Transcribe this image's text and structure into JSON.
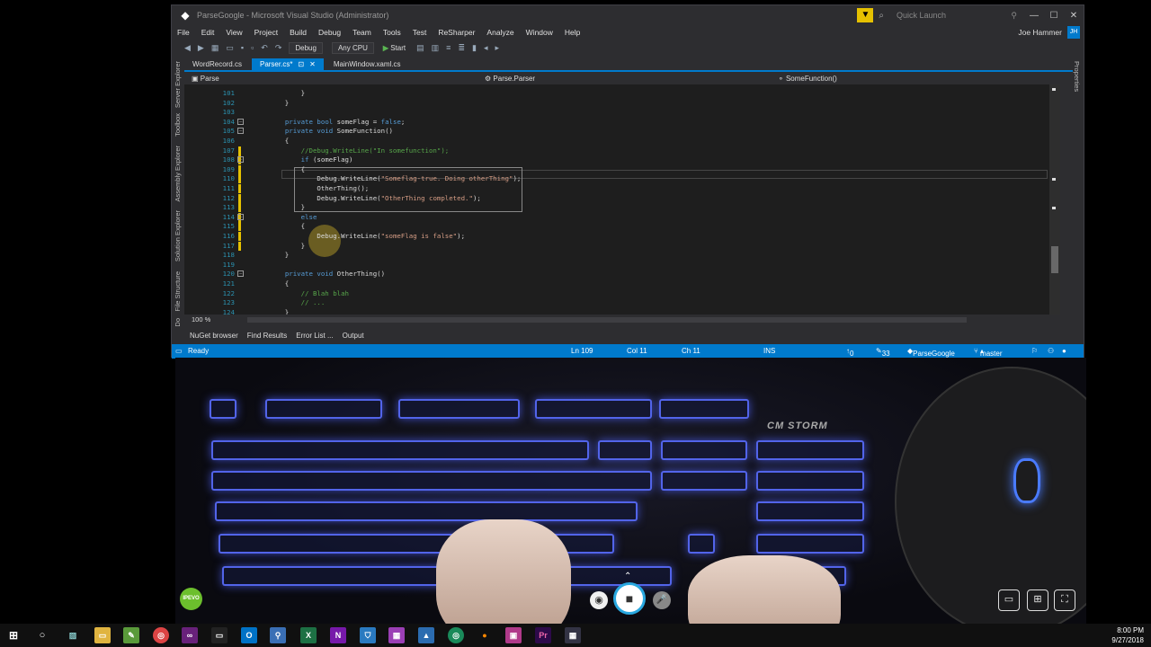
{
  "window": {
    "title": "ParseGoogle - Microsoft Visual Studio (Administrator)",
    "quick_launch_placeholder": "Quick Launch",
    "min": "—",
    "max": "☐",
    "close": "✕"
  },
  "menu": {
    "items": [
      "File",
      "Edit",
      "View",
      "Project",
      "Build",
      "Debug",
      "Team",
      "Tools",
      "Test",
      "ReSharper",
      "Analyze",
      "Window",
      "Help"
    ],
    "user": "Joe Hammer",
    "user_initials": "JH"
  },
  "toolbar": {
    "config": "Debug",
    "platform": "Any CPU",
    "start_label": "Start"
  },
  "tabs": [
    {
      "label": "WordRecord.cs",
      "active": false
    },
    {
      "label": "Parser.cs*",
      "active": true
    },
    {
      "label": "MainWindow.xaml.cs",
      "active": false
    }
  ],
  "navbar": {
    "project": "Parse",
    "class": "Parse.Parser",
    "member": "SomeFunction()"
  },
  "side_panels": {
    "left": [
      "Server Explorer",
      "Toolbox",
      "Assembly Explorer",
      "Solution Explorer",
      "File Structure",
      "Do"
    ],
    "right": "Properties"
  },
  "code_lines": [
    {
      "n": "101",
      "text": "        }"
    },
    {
      "n": "102",
      "text": "    }"
    },
    {
      "n": "103",
      "text": ""
    },
    {
      "n": "104",
      "text": "    private bool someFlag = false;"
    },
    {
      "n": "105",
      "text": "    private void SomeFunction()"
    },
    {
      "n": "106",
      "text": "    {"
    },
    {
      "n": "107",
      "text": "        //Debug.WriteLine(\"In somefunction\");"
    },
    {
      "n": "108",
      "text": "        if (someFlag)"
    },
    {
      "n": "109",
      "text": "        {"
    },
    {
      "n": "110",
      "text": "            Debug.WriteLine(\"Someflag-true. Doing otherThing\");"
    },
    {
      "n": "111",
      "text": "            OtherThing();"
    },
    {
      "n": "112",
      "text": "            Debug.WriteLine(\"OtherThing completed.\");"
    },
    {
      "n": "113",
      "text": "        }"
    },
    {
      "n": "114",
      "text": "        else"
    },
    {
      "n": "115",
      "text": "        {"
    },
    {
      "n": "116",
      "text": "            Debug.WriteLine(\"someFlag is false\");"
    },
    {
      "n": "117",
      "text": "        }"
    },
    {
      "n": "118",
      "text": "    }"
    },
    {
      "n": "119",
      "text": ""
    },
    {
      "n": "120",
      "text": "    private void OtherThing()"
    },
    {
      "n": "121",
      "text": "    {"
    },
    {
      "n": "122",
      "text": "        // Blah blah"
    },
    {
      "n": "123",
      "text": "        // ..."
    },
    {
      "n": "124",
      "text": "    }"
    }
  ],
  "zoom": "100 %",
  "bottom_tabs": [
    "NuGet browser",
    "Find Results",
    "Error List ...",
    "Output"
  ],
  "status": {
    "state": "Ready",
    "ln": "Ln 109",
    "col": "Col 11",
    "ch": "Ch 11",
    "mode": "INS",
    "up": "0",
    "pencil": "33",
    "repo": "ParseGoogle",
    "branch": "master"
  },
  "webcam": {
    "badge": "IPEVO",
    "brand": "CM STORM"
  },
  "clock": {
    "time": "8:00 PM",
    "date": "9/27/2018"
  }
}
